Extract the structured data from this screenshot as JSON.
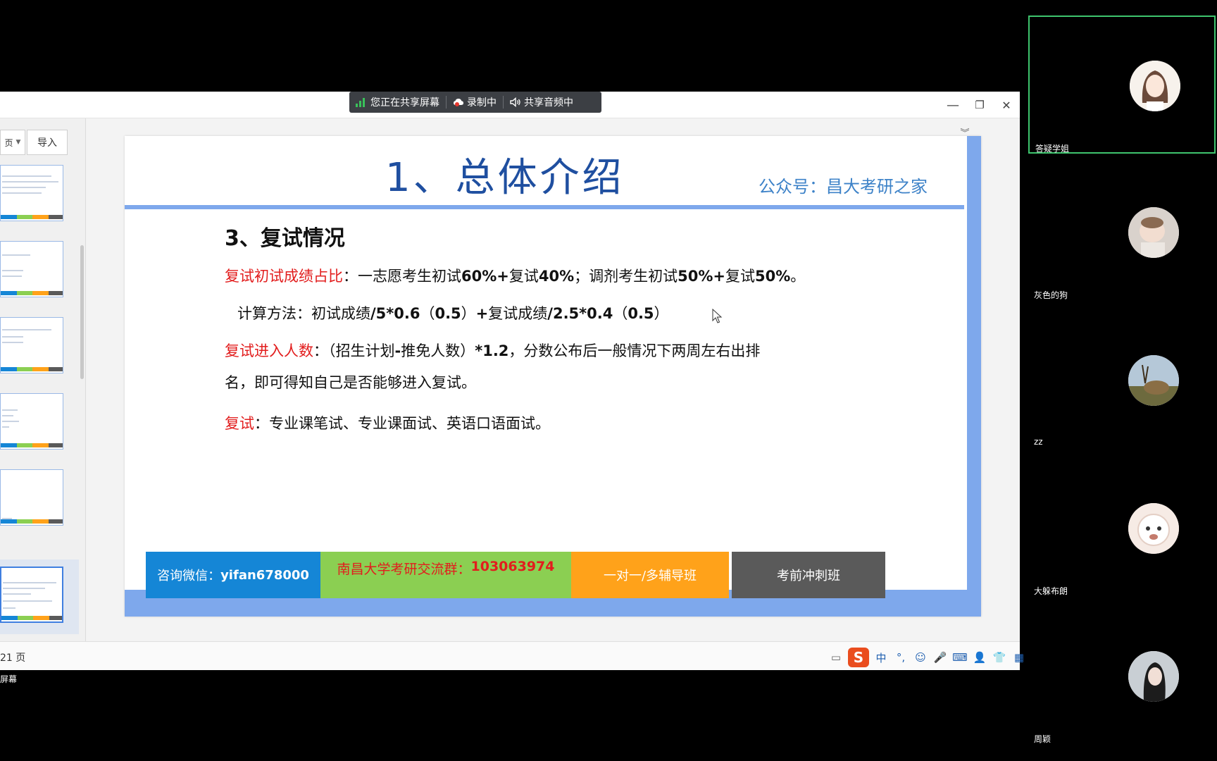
{
  "share_bar": {
    "sharing_label": "您正在共享屏幕",
    "recording_label": "录制中",
    "audio_label": "共享音频中"
  },
  "window_controls": {
    "minimize": "—",
    "restore": "❐",
    "close": "✕"
  },
  "thumb_pane": {
    "dropdown_label": "页",
    "import_label": "导入"
  },
  "slide": {
    "title": "1、总体介绍",
    "account": "公众号：昌大考研之家",
    "section_heading": "3、复试情况",
    "p1_label": "复试初试成绩占比",
    "p1_text": "：一志愿考生初试",
    "p1_b1": "60%+",
    "p1_t2": "复试",
    "p1_b2": "40%",
    "p1_t3": "；调剂考生初试",
    "p1_b3": "50%+",
    "p1_t4": "复试",
    "p1_b4": "50%",
    "p1_t5": "。",
    "p2_text": "计算方法：初试成绩",
    "p2_b1": "/5*0.6",
    "p2_t2": "（",
    "p2_b2": "0.5",
    "p2_t3": "）",
    "p2_b3": "+",
    "p2_t4": "复试成绩",
    "p2_b4": "/2.5*0.4",
    "p2_t5": "（",
    "p2_b5": "0.5",
    "p2_t6": "）",
    "p3_label": "复试进入人数",
    "p3_text": "：（招生计划",
    "p3_b1": "-",
    "p3_t2": "推免人数）",
    "p3_b2": "*1.2",
    "p3_t3": "，分数公布后一般情况下两周左右出排",
    "p3_line2": "名，即可得知自己是否能够进入复试。",
    "p4_label": "复试",
    "p4_text": "：专业课笔试、专业课面试、英语口语面试。",
    "footer": {
      "consult_prefix": "咨询微信：",
      "consult_id": "yifan678000",
      "group_prefix": "南昌大学考研交流群：",
      "group_id": "103063974",
      "tutoring": "一对一/多辅导班",
      "sprint": "考前冲刺班"
    }
  },
  "status_bar": {
    "page_label": "21 页",
    "ime_lang": "中"
  },
  "screen_label": "屏幕",
  "participants": [
    {
      "name": "答疑学姐",
      "color": "#efe6de",
      "accent": "#6b4a3a"
    },
    {
      "name": "灰色的狗",
      "color": "#cbb7a4",
      "accent": "#8a6a52"
    },
    {
      "name": "zz",
      "color": "#8a6e45",
      "accent": "#3e2f1c"
    },
    {
      "name": "大躲布朗",
      "color": "#f1d8d0",
      "accent": "#c47b6c"
    },
    {
      "name": "周颖",
      "color": "#b9c0c6",
      "accent": "#1c1c1c"
    }
  ],
  "colors": {
    "slide_blue": "#7ea8ec",
    "title_blue": "#1f4fa0",
    "red_label": "#e21d1d",
    "active_speaker": "#3ec46d"
  }
}
